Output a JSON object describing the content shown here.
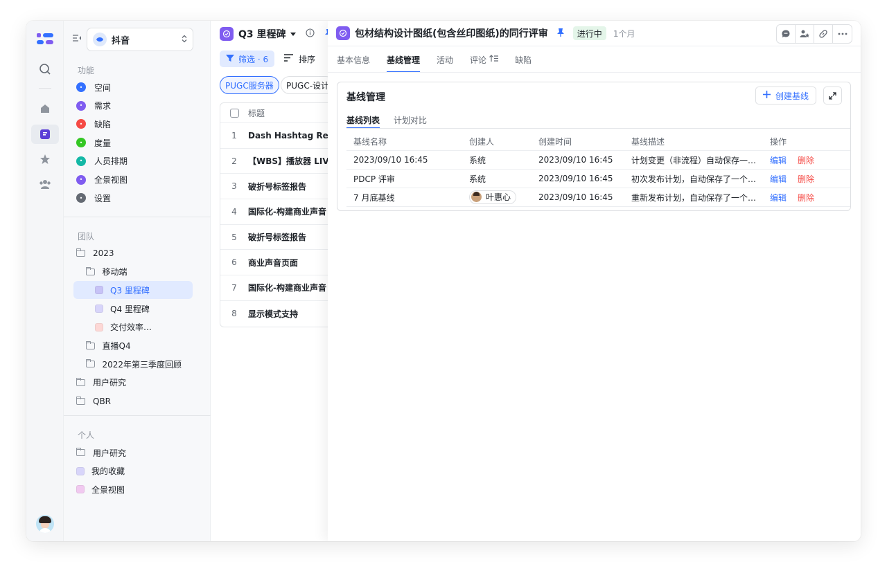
{
  "sidebar": {
    "workspace": "抖音",
    "functions_title": "功能",
    "functions": [
      {
        "label": "空间",
        "color": "#3370ff",
        "icon": "space-icon"
      },
      {
        "label": "需求",
        "color": "#7f5cf0",
        "icon": "requirement-icon"
      },
      {
        "label": "缺陷",
        "color": "#f54a45",
        "icon": "bug-icon"
      },
      {
        "label": "度量",
        "color": "#34c724",
        "icon": "metric-icon"
      },
      {
        "label": "人员排期",
        "color": "#14b8a6",
        "icon": "schedule-icon"
      },
      {
        "label": "全景视图",
        "color": "#7f5cf0",
        "icon": "panorama-icon"
      },
      {
        "label": "设置",
        "color": "#646a73",
        "icon": "settings-icon"
      }
    ],
    "team_title": "团队",
    "team": [
      {
        "label": "2023",
        "level": 0,
        "type": "folder"
      },
      {
        "label": "移动端",
        "level": 1,
        "type": "folder"
      },
      {
        "label": "Q3 里程碑",
        "level": 2,
        "type": "view",
        "color": "#c7c3f7",
        "selected": true
      },
      {
        "label": "Q4 里程碑",
        "level": 2,
        "type": "view",
        "color": "#d8d5fa"
      },
      {
        "label": "交付效率…",
        "level": 2,
        "type": "view",
        "color": "#fdd8d6"
      },
      {
        "label": "直播Q4",
        "level": 1,
        "type": "folder"
      },
      {
        "label": "2022年第三季度回顾",
        "level": 1,
        "type": "folder"
      },
      {
        "label": "用户研究",
        "level": 0,
        "type": "folder"
      },
      {
        "label": "QBR",
        "level": 0,
        "type": "folder"
      }
    ],
    "personal_title": "个人",
    "personal": [
      {
        "label": "用户研究",
        "type": "folder"
      },
      {
        "label": "我的收藏",
        "type": "view",
        "color": "#d8d5fa"
      },
      {
        "label": "全景视图",
        "type": "view",
        "color": "#f1c9f0"
      }
    ]
  },
  "list": {
    "title": "Q3 里程碑",
    "filter_label": "筛选 · 6",
    "sort_label": "排序",
    "chips": [
      "PUGC服务器",
      "PUGC-设计"
    ],
    "header_title": "标题",
    "rows": [
      {
        "no": "1",
        "title": "Dash Hashtag Report"
      },
      {
        "no": "2",
        "title": "【WBS】播放器 LIVE"
      },
      {
        "no": "3",
        "title": "破折号标签报告"
      },
      {
        "no": "4",
        "title": "国际化-构建商业声音"
      },
      {
        "no": "5",
        "title": "破折号标签报告"
      },
      {
        "no": "6",
        "title": "商业声音页面"
      },
      {
        "no": "7",
        "title": "国际化-构建商业声音"
      },
      {
        "no": "8",
        "title": "显示模式支持"
      }
    ]
  },
  "detail": {
    "title": "包材结构设计图纸(包含丝印图纸)的同行评审",
    "status": "进行中",
    "duration": "1个月",
    "tabs": [
      "基本信息",
      "基线管理",
      "活动",
      "评论",
      "缺陷"
    ],
    "card_title": "基线管理",
    "create_label": "创建基线",
    "subtabs": [
      "基线列表",
      "计划对比"
    ],
    "columns": [
      "基线名称",
      "创建人",
      "创建时间",
      "基线描述",
      "操作"
    ],
    "rows": [
      {
        "name": "2023/09/10 16:45",
        "creator": "系统",
        "time": "2023/09/10 16:45",
        "desc": "计划变更（非流程）自动保存一…",
        "edit": "编辑",
        "del": "删除",
        "person": false
      },
      {
        "name": "PDCP 评审",
        "creator": "系统",
        "time": "2023/09/10 16:45",
        "desc": "初次发布计划，自动保存了一个…",
        "edit": "编辑",
        "del": "删除",
        "person": false
      },
      {
        "name": "7 月底基线",
        "creator": "叶惠心",
        "time": "2023/09/10 16:45",
        "desc": "重新发布计划，自动保存了一个…",
        "edit": "编辑",
        "del": "删除",
        "person": true
      }
    ]
  }
}
